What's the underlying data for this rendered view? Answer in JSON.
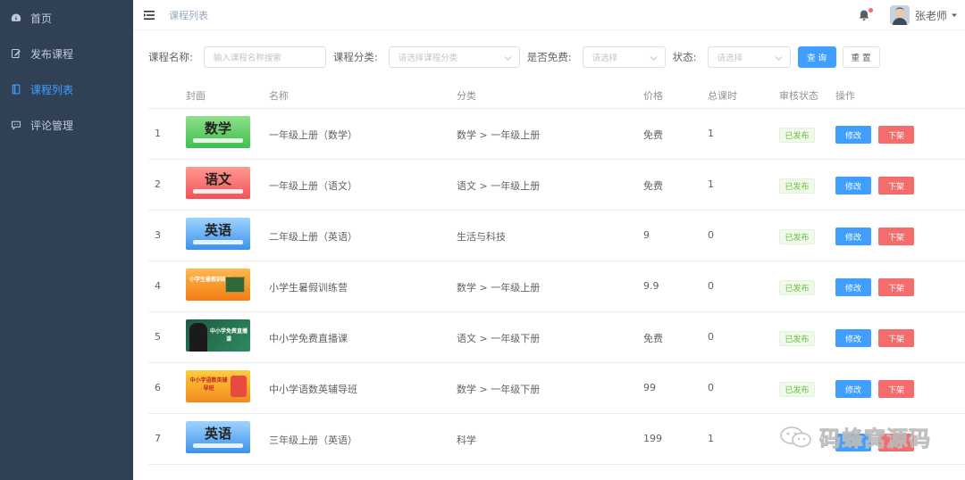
{
  "sidebar": {
    "items": [
      {
        "label": "首页",
        "icon": "dashboard-icon",
        "active": false
      },
      {
        "label": "发布课程",
        "icon": "edit-icon",
        "active": false
      },
      {
        "label": "课程列表",
        "icon": "document-icon",
        "active": true
      },
      {
        "label": "评论管理",
        "icon": "comment-icon",
        "active": false
      }
    ]
  },
  "header": {
    "breadcrumb": "课程列表",
    "username": "张老师"
  },
  "filters": {
    "name_label": "课程名称:",
    "name_placeholder": "输入课程名称搜索",
    "category_label": "课程分类:",
    "category_placeholder": "请选择课程分类",
    "free_label": "是否免费:",
    "free_placeholder": "请选择",
    "status_label": "状态:",
    "status_placeholder": "请选择",
    "search_button": "查 询",
    "reset_button": "重 置"
  },
  "table": {
    "headers": [
      "封面",
      "名称",
      "分类",
      "价格",
      "总课时",
      "审核状态",
      "操作"
    ],
    "rows": [
      {
        "index": "1",
        "cover": "数学",
        "name": "一年级上册（数学）",
        "category": "数学 > 一年级上册",
        "price": "免费",
        "hours": "1",
        "status": "已发布",
        "edit": "修改",
        "off": "下架"
      },
      {
        "index": "2",
        "cover": "语文",
        "name": "一年级上册（语文）",
        "category": "语文 > 一年级上册",
        "price": "免费",
        "hours": "1",
        "status": "已发布",
        "edit": "修改",
        "off": "下架"
      },
      {
        "index": "3",
        "cover": "英语",
        "name": "二年级上册（英语）",
        "category": "生活与科技",
        "price": "9",
        "hours": "0",
        "status": "已发布",
        "edit": "修改",
        "off": "下架"
      },
      {
        "index": "4",
        "cover": "小学生暑假训练营",
        "name": "小学生暑假训练营",
        "category": "数学 > 一年级上册",
        "price": "9.9",
        "hours": "0",
        "status": "已发布",
        "edit": "修改",
        "off": "下架"
      },
      {
        "index": "5",
        "cover": "中小学免费直播课",
        "name": "中小学免费直播课",
        "category": "语文 > 一年级下册",
        "price": "免费",
        "hours": "0",
        "status": "已发布",
        "edit": "修改",
        "off": "下架"
      },
      {
        "index": "6",
        "cover": "中小学语数英辅导班",
        "name": "中小学语数英辅导班",
        "category": "数学 > 一年级下册",
        "price": "99",
        "hours": "0",
        "status": "已发布",
        "edit": "修改",
        "off": "下架"
      },
      {
        "index": "7",
        "cover": "英语",
        "name": "三年级上册（英语）",
        "category": "科学",
        "price": "199",
        "hours": "1",
        "status": "",
        "edit": "",
        "off": ""
      }
    ]
  },
  "watermark": "码蜂窝源码",
  "colors": {
    "sidebar_bg": "#304156",
    "primary": "#409eff",
    "danger": "#f56c6c",
    "success": "#67c23a"
  }
}
